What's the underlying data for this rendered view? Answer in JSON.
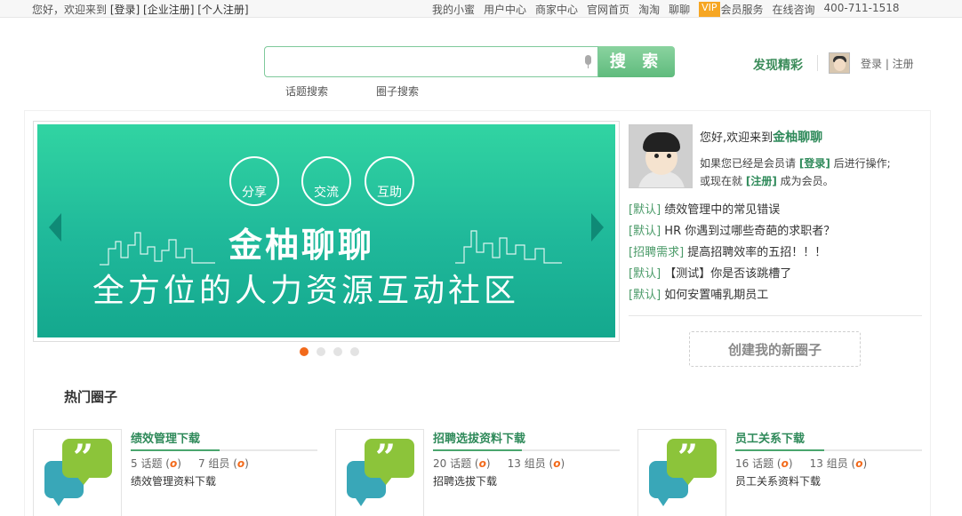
{
  "topbar": {
    "greeting": "您好，欢迎来到",
    "login": "[登录]",
    "corp_register": "[企业注册]",
    "personal_register": "[个人注册]",
    "links": [
      "我的小蜜",
      "用户中心",
      "商家中心",
      "官网首页",
      "淘淘",
      "聊聊"
    ],
    "vip_badge": "VIP",
    "member_service": "会员服务",
    "consult": "在线咨询",
    "phone": "400-711-1518"
  },
  "header": {
    "search_placeholder": "",
    "search_button": "搜 索",
    "search_tabs": [
      "话题搜索",
      "圈子搜索"
    ],
    "discover": "发现精彩",
    "login_register": "登录 | 注册"
  },
  "banner": {
    "icons": [
      "分享",
      "交流",
      "互助"
    ],
    "title": "金柚聊聊",
    "subtitle": "全方位的人力资源互动社区",
    "slide_count": 4,
    "active_slide": 1
  },
  "welcome": {
    "hello": "您好,欢迎来到",
    "site_name": "金柚聊聊",
    "line1_pre": "如果您已经是会员请",
    "line1_link": "[登录]",
    "line1_post": "后进行操作;",
    "line2_pre": "或现在就",
    "line2_link": "[注册]",
    "line2_post": "成为会员。"
  },
  "topics": [
    {
      "tag": "[默认]",
      "title": "绩效管理中的常见错误"
    },
    {
      "tag": "[默认]",
      "title": "HR 你遇到过哪些奇葩的求职者？"
    },
    {
      "tag": "[招聘需求]",
      "title": "提高招聘效率的五招！！！"
    },
    {
      "tag": "[默认]",
      "title": "【测试】你是否该跳槽了"
    },
    {
      "tag": "[默认]",
      "title": "如何安置哺乳期员工"
    }
  ],
  "create_circle": "创建我的新圈子",
  "hot_section_title": "热门圈子",
  "hot_circles": [
    {
      "name": "绩效管理下载",
      "topics": "5 话题",
      "members": "7 组员",
      "badge": "o",
      "desc": "绩效管理资料下载"
    },
    {
      "name": "招聘选拔资料下载",
      "topics": "20 话题",
      "members": "13 组员",
      "badge": "o",
      "desc": "招聘选拔下载"
    },
    {
      "name": "员工关系下载",
      "topics": "16 话题",
      "members": "13 组员",
      "badge": "o",
      "desc": "员工关系资料下载"
    }
  ],
  "colors": {
    "brand_green": "#2f8a5a",
    "banner_teal": "#1fb89a",
    "accent_orange": "#f26a1b",
    "vip_orange": "#f6a623"
  }
}
